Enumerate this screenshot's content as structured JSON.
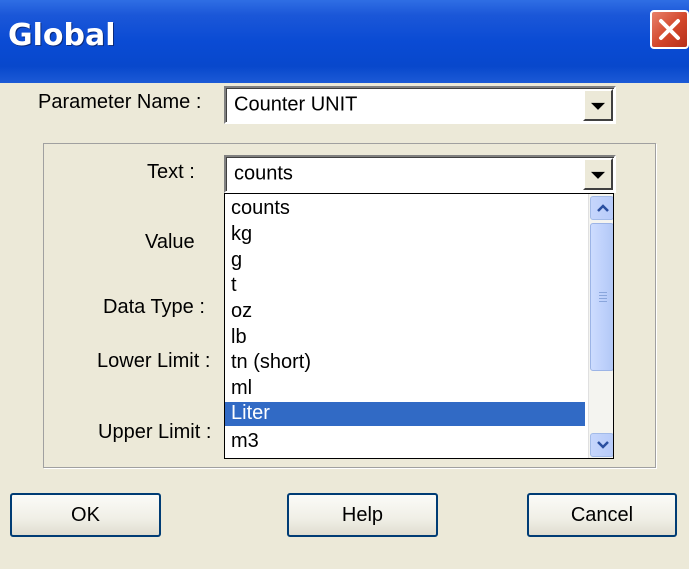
{
  "window": {
    "title": "Global",
    "close_icon": "close-icon"
  },
  "form": {
    "parameter_name_label": "Parameter Name :",
    "parameter_name_value": "Counter UNIT",
    "text_label": "Text :",
    "text_value": "counts",
    "value_label": "Value",
    "data_type_label": "Data Type :",
    "lower_limit_label": "Lower Limit :",
    "upper_limit_label": "Upper Limit :"
  },
  "dropdown": {
    "items": [
      "counts",
      "kg",
      "g",
      "t",
      "oz",
      "lb",
      "tn (short)",
      "ml",
      "Liter",
      "m3"
    ],
    "selected": "Liter"
  },
  "buttons": {
    "ok": "OK",
    "help": "Help",
    "cancel": "Cancel"
  },
  "colors": {
    "titlebar": "#0a4bd4",
    "selection": "#316ac5",
    "dialog_bg": "#ece9d8",
    "close_button": "#d2462a"
  }
}
